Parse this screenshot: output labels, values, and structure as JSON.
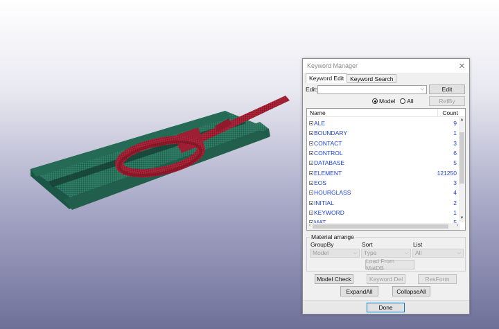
{
  "dialog": {
    "title": "Keyword Manager",
    "close_glyph": "✕",
    "tabs": [
      {
        "label": "Keyword Edit"
      },
      {
        "label": "Keyword Search"
      }
    ],
    "edit_label": "Edit:",
    "edit_button": "Edit",
    "refby_button": "RefBy",
    "radio_model": "Model",
    "radio_all": "All",
    "list_header_name": "Name",
    "list_header_count": "Count",
    "keywords": [
      {
        "name": "ALE",
        "count": "9"
      },
      {
        "name": "BOUNDARY",
        "count": "1"
      },
      {
        "name": "CONTACT",
        "count": "3"
      },
      {
        "name": "CONTROL",
        "count": "6"
      },
      {
        "name": "DATABASE",
        "count": "5"
      },
      {
        "name": "ELEMENT",
        "count": "121250"
      },
      {
        "name": "EOS",
        "count": "3"
      },
      {
        "name": "HOURGLASS",
        "count": "4"
      },
      {
        "name": "INITIAL",
        "count": "2"
      },
      {
        "name": "KEYWORD",
        "count": "1"
      },
      {
        "name": "MAT",
        "count": "5"
      }
    ],
    "material_arrange": {
      "title": "Material arrange",
      "groupby_label": "GroupBy",
      "sort_label": "Sort",
      "list_label": "List",
      "groupby_value": "Model",
      "sort_value": "Type",
      "list_value": "All",
      "load_button": "Load From MatDB"
    },
    "model_check_button": "Model Check",
    "keyword_del_button": "Keyword Del",
    "resform_button": "ResForm",
    "expand_all_button": "ExpandAll",
    "collapse_all_button": "CollapseAll",
    "done_button": "Done"
  },
  "colors": {
    "plate_mesh": "#2c8a6a",
    "ring_mesh": "#a3202e",
    "keyword_link": "#1a3fd6",
    "background_bottom": "#6f7099"
  },
  "icons": [
    "close-icon",
    "chevron-down-icon",
    "expand-node-icon",
    "scroll-up-icon",
    "scroll-down-icon",
    "scroll-left-icon",
    "scroll-right-icon"
  ]
}
